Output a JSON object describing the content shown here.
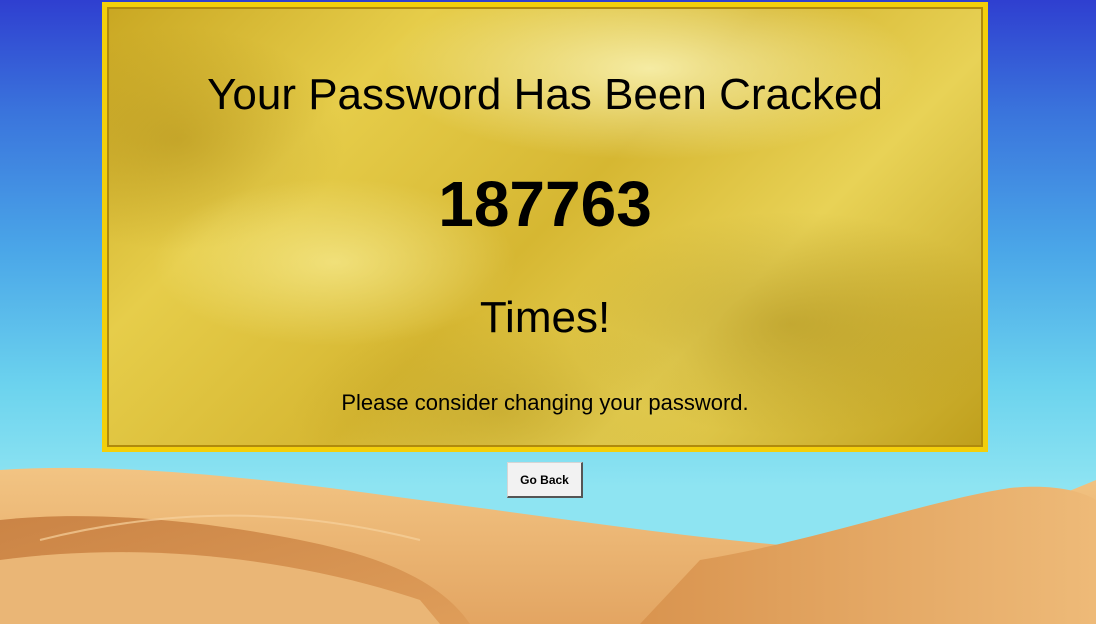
{
  "panel": {
    "title": "Your Password Has Been Cracked",
    "count": "187763",
    "times_label": "Times!",
    "notice": "Please consider changing your password."
  },
  "actions": {
    "back_label": "Go Back"
  },
  "colors": {
    "panel_border": "#f3cf0b",
    "gold": "#d6b732",
    "sky_top": "#2f3fd0",
    "sky_bottom": "#8ee4f2",
    "sand": "#e9ae67"
  }
}
